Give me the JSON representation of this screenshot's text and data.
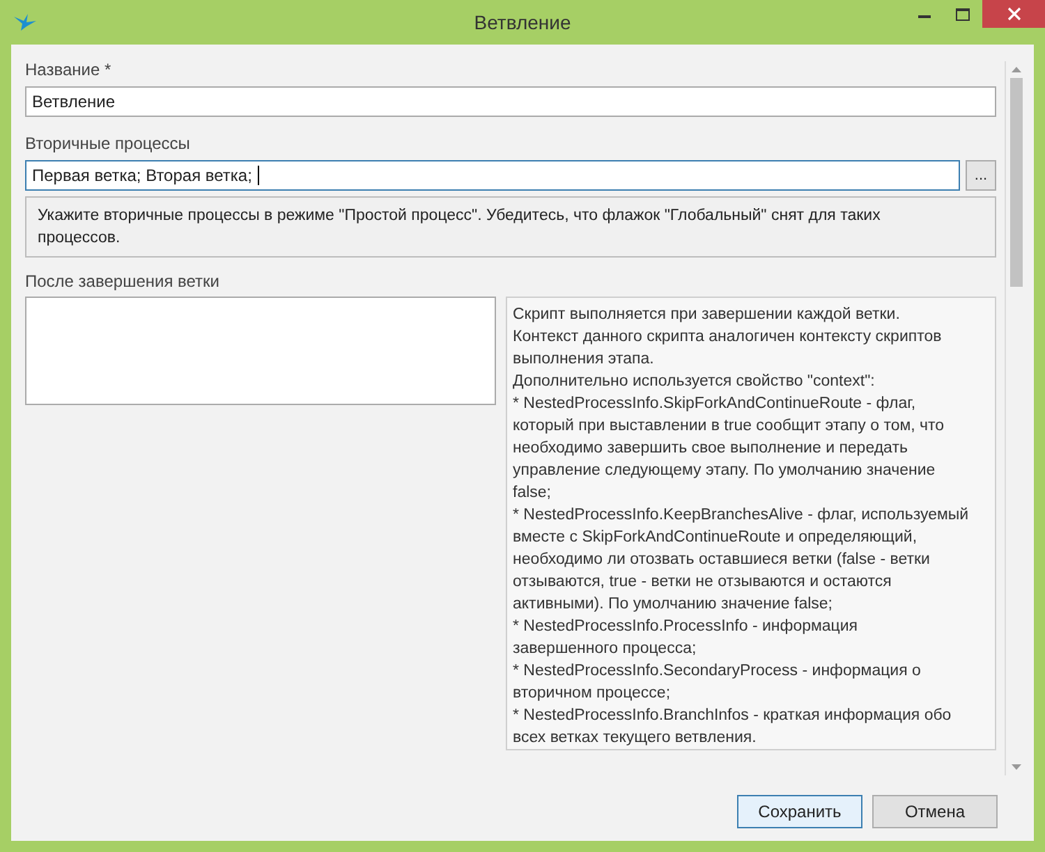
{
  "window": {
    "title": "Ветвление"
  },
  "name_field": {
    "label": "Название",
    "required_mark": "*",
    "value": "Ветвление"
  },
  "secondary_field": {
    "label": "Вторичные процессы",
    "value": "Первая ветка; Вторая ветка;",
    "browse_button": "...",
    "focused": true
  },
  "secondary_hint": "Укажите вторичные процессы в режиме \"Простой процесс\". Убедитесь, что флажок \"Глобальный\" снят для таких процессов.",
  "after_branch": {
    "label": "После завершения ветки",
    "help_lines": [
      "Скрипт выполняется при завершении каждой ветки.",
      "Контекст данного скрипта аналогичен контексту скриптов",
      "выполнения этапа.",
      "Дополнительно используется свойство \"context\":",
      "* NestedProcessInfo.SkipForkAndContinueRoute - флаг,",
      "который при выставлении в true сообщит этапу о том, что",
      "необходимо завершить свое выполнение и передать",
      "управление следующему этапу. По умолчанию значение",
      "false;",
      "* NestedProcessInfo.KeepBranchesAlive - флаг, используемый",
      "вместе с SkipForkAndContinueRoute и определяющий,",
      "необходимо ли отозвать оставшиеся ветки (false - ветки",
      "отзываются, true - ветки не отзываются и остаются",
      "активными). По умолчанию значение false;",
      "* NestedProcessInfo.ProcessInfo - информация",
      "завершенного процесса;",
      "* NestedProcessInfo.SecondaryProcess - информация о",
      "вторичном процессе;",
      "* NestedProcessInfo.BranchInfos - краткая информация обо",
      "всех ветках текущего ветвления."
    ]
  },
  "buttons": [
    {
      "label": "Сохранить",
      "selected": true
    },
    {
      "label": "Отмена",
      "selected": false
    }
  ]
}
